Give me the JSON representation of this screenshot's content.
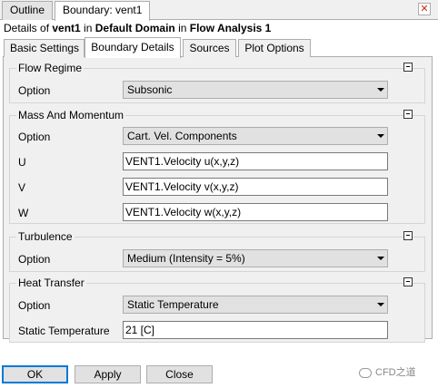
{
  "top_tabs": [
    {
      "label": "Outline",
      "active": false
    },
    {
      "label": "Boundary: vent1",
      "active": true
    }
  ],
  "close_icon": "close-icon",
  "details": {
    "prefix": "Details of ",
    "object": "vent1",
    "in1": " in ",
    "domain": "Default Domain",
    "in2": " in ",
    "analysis": "Flow Analysis 1"
  },
  "inner_tabs": [
    {
      "label": "Basic Settings",
      "active": false
    },
    {
      "label": "Boundary Details",
      "active": true
    },
    {
      "label": "Sources",
      "active": false
    },
    {
      "label": "Plot Options",
      "active": false
    }
  ],
  "flow_regime": {
    "title": "Flow Regime",
    "option_label": "Option",
    "option_value": "Subsonic"
  },
  "mass_momentum": {
    "title": "Mass And Momentum",
    "option_label": "Option",
    "option_value": "Cart. Vel. Components",
    "u_label": "U",
    "u_value": "VENT1.Velocity u(x,y,z)",
    "v_label": "V",
    "v_value": "VENT1.Velocity v(x,y,z)",
    "w_label": "W",
    "w_value": "VENT1.Velocity w(x,y,z)"
  },
  "turbulence": {
    "title": "Turbulence",
    "option_label": "Option",
    "option_value": "Medium (Intensity = 5%)"
  },
  "heat_transfer": {
    "title": "Heat Transfer",
    "option_label": "Option",
    "option_value": "Static Temperature",
    "temp_label": "Static Temperature",
    "temp_value": "21 [C]"
  },
  "buttons": {
    "ok": "OK",
    "apply": "Apply",
    "close": "Close"
  },
  "watermark": "CFD之道",
  "colors": {
    "accent": "#0078d7",
    "close_x": "#c42b1c"
  }
}
